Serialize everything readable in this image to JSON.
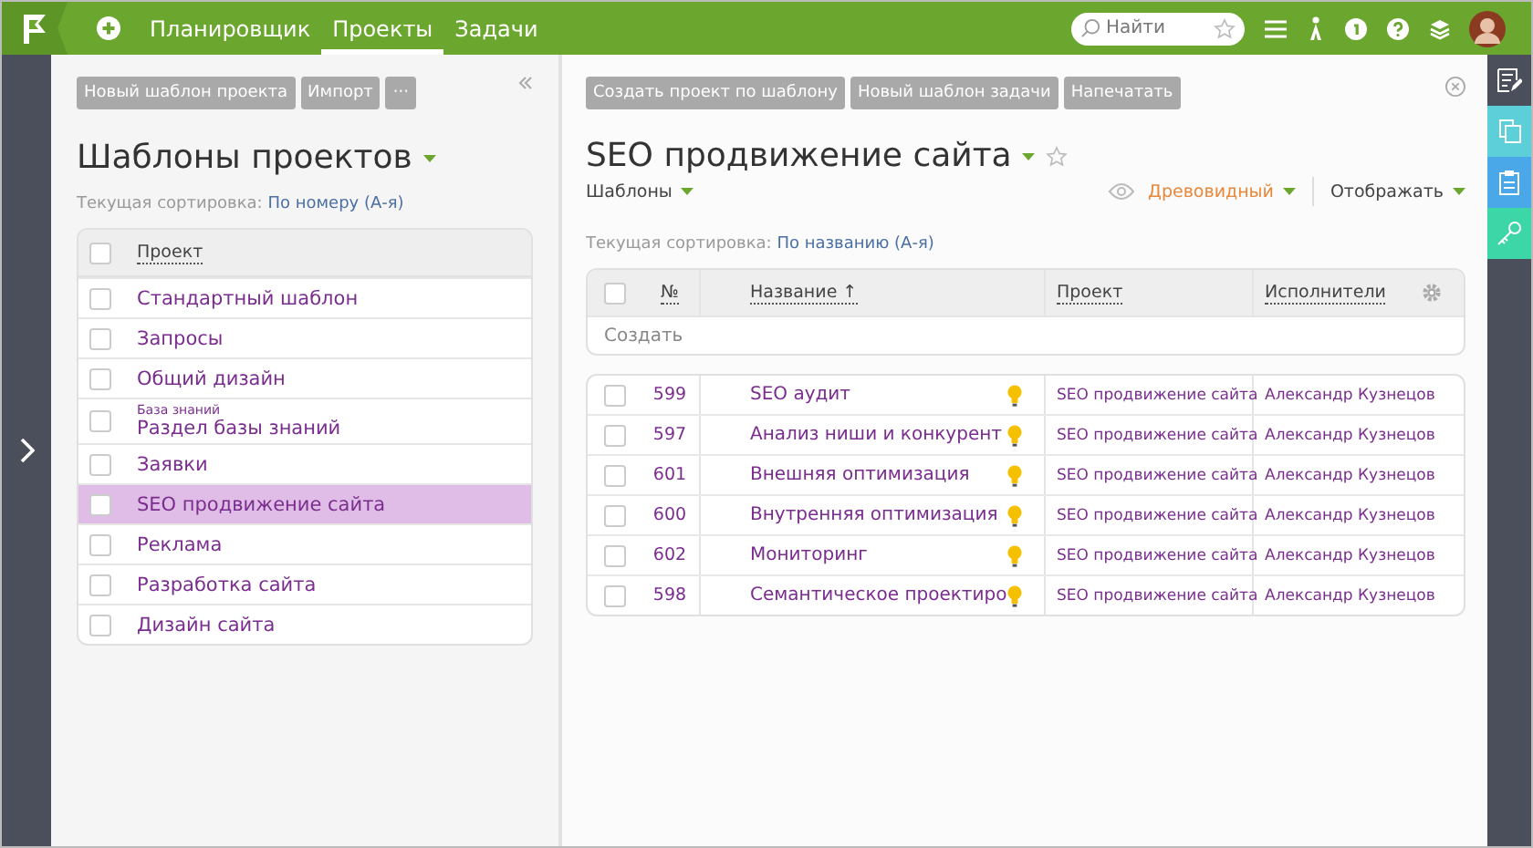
{
  "nav": {
    "items": [
      {
        "label": "Планировщик",
        "selected": false
      },
      {
        "label": "Проекты",
        "selected": true
      },
      {
        "label": "Задачи",
        "selected": false
      }
    ],
    "search": {
      "placeholder": "Найти"
    }
  },
  "left": {
    "buttons": [
      "Новый шаблон проекта",
      "Импорт",
      "···"
    ],
    "title": "Шаблоны проектов",
    "sort_label": "Текущая сортировка:",
    "sort_value": "По номеру (А-я)",
    "column": "Проект",
    "header_checked": false,
    "items": [
      {
        "name": "Стандартный шаблон",
        "selected": false,
        "checked": false
      },
      {
        "name": "Запросы",
        "selected": false,
        "checked": false
      },
      {
        "name": "Общий дизайн",
        "selected": false,
        "checked": false
      },
      {
        "category": "База знаний",
        "name": "Раздел базы знаний",
        "selected": false,
        "checked": false
      },
      {
        "name": "Заявки",
        "selected": false,
        "checked": false
      },
      {
        "name": "SEO продвижение сайта",
        "selected": true,
        "checked": false
      },
      {
        "name": "Реклама",
        "selected": false,
        "checked": false
      },
      {
        "name": "Разработка сайта",
        "selected": false,
        "checked": false
      },
      {
        "name": "Дизайн сайта",
        "selected": false,
        "checked": false
      }
    ]
  },
  "right": {
    "buttons": [
      "Создать проект по шаблону",
      "Новый шаблон задачи",
      "Напечатать"
    ],
    "title": "SEO продвижение сайта",
    "subtitle": "Шаблоны",
    "view": "Древовидный",
    "display": "Отображать",
    "sort_label": "Текущая сортировка:",
    "sort_value": "По названию (А-я)",
    "header_checked": false,
    "columns": [
      "№",
      "Название ↑",
      "Проект",
      "Исполнители"
    ],
    "create": "Создать",
    "rows": [
      {
        "num": "599",
        "name": "SEO аудит",
        "project": "SEO продвижение сайта",
        "assignee": "Александр Кузнецов",
        "checked": false
      },
      {
        "num": "597",
        "name": "Анализ ниши и конкурент",
        "project": "SEO продвижение сайта",
        "assignee": "Александр Кузнецов",
        "checked": false
      },
      {
        "num": "601",
        "name": "Внешняя оптимизация",
        "project": "SEO продвижение сайта",
        "assignee": "Александр Кузнецов",
        "checked": false
      },
      {
        "num": "600",
        "name": "Внутренняя оптимизация",
        "project": "SEO продвижение сайта",
        "assignee": "Александр Кузнецов",
        "checked": false
      },
      {
        "num": "602",
        "name": "Мониторинг",
        "project": "SEO продвижение сайта",
        "assignee": "Александр Кузнецов",
        "checked": false
      },
      {
        "num": "598",
        "name": "Семантическое проектиро",
        "project": "SEO продвижение сайта",
        "assignee": "Александр Кузнецов",
        "checked": false
      }
    ]
  }
}
